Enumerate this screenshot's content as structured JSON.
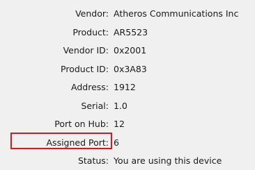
{
  "properties": [
    {
      "label": "Vendor:",
      "value": "Atheros Communications Inc"
    },
    {
      "label": "Product:",
      "value": "AR5523"
    },
    {
      "label": "Vendor ID:",
      "value": "0x2001"
    },
    {
      "label": "Product ID:",
      "value": "0x3A83"
    },
    {
      "label": "Address:",
      "value": "1912"
    },
    {
      "label": "Serial:",
      "value": "1.0"
    },
    {
      "label": "Port on Hub:",
      "value": "12"
    },
    {
      "label": "Assigned Port:",
      "value": "6"
    },
    {
      "label": "Status:",
      "value": "You are using this device"
    }
  ],
  "highlight_color": "#e1141e"
}
